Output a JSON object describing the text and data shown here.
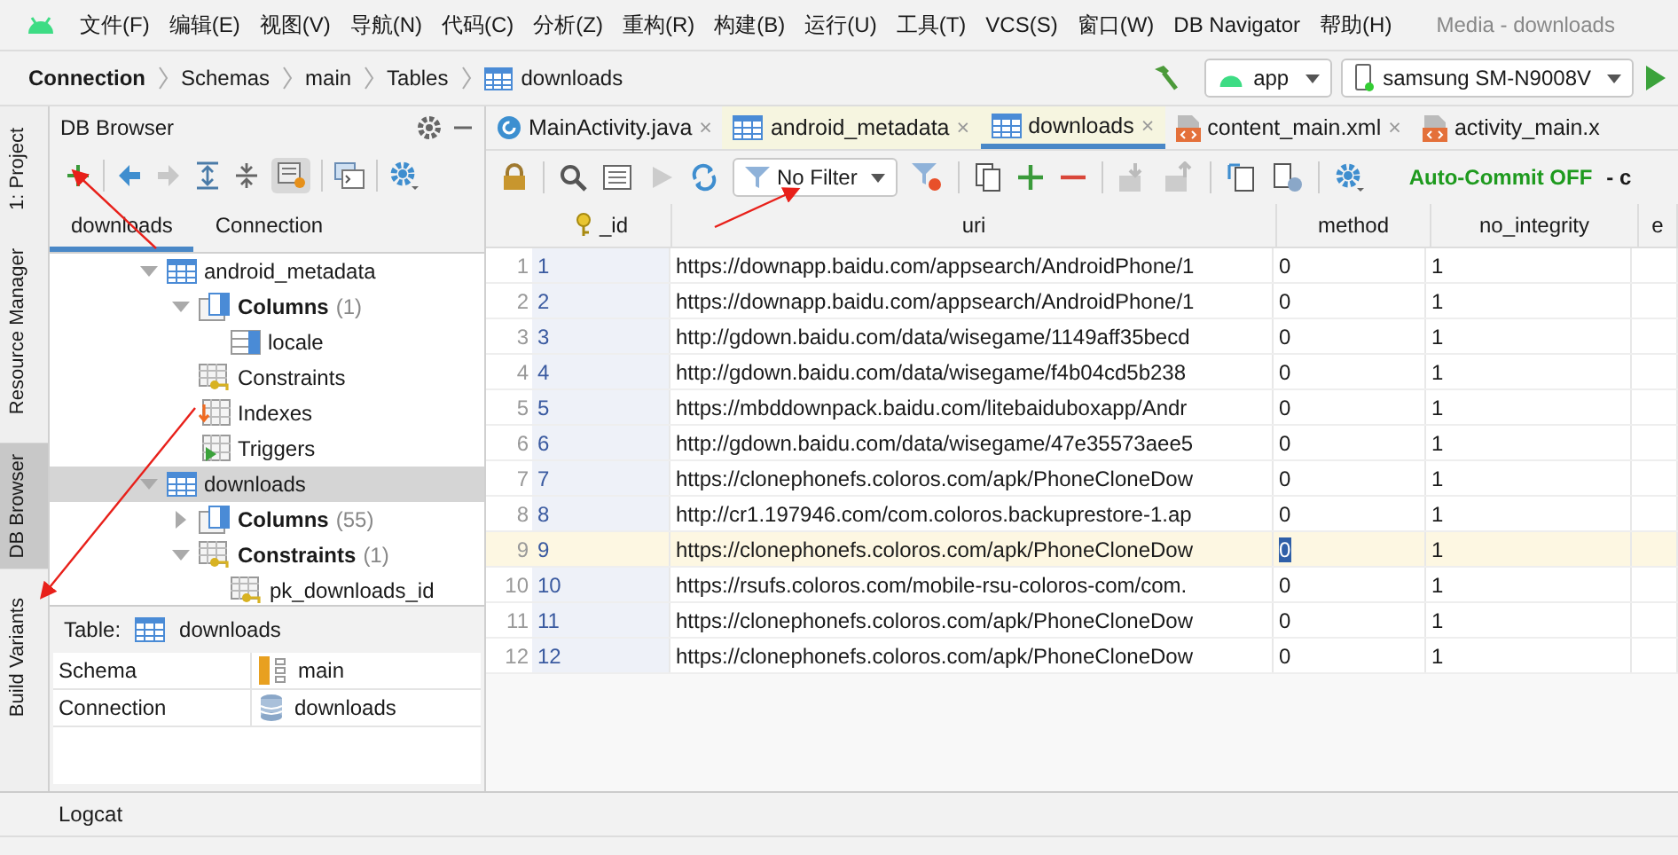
{
  "menu_bar": {
    "items": [
      "文件(F)",
      "编辑(E)",
      "视图(V)",
      "导航(N)",
      "代码(C)",
      "分析(Z)",
      "重构(R)",
      "构建(B)",
      "运行(U)",
      "工具(T)",
      "VCS(S)",
      "窗口(W)",
      "DB Navigator",
      "帮助(H)"
    ],
    "window_title": "Media - downloads"
  },
  "nav_bar": {
    "breadcrumbs": [
      {
        "label": "Connection",
        "kind": "bold"
      },
      {
        "label": "Schemas",
        "kind": "plain"
      },
      {
        "label": "main",
        "kind": "plain"
      },
      {
        "label": "Tables",
        "kind": "plain"
      },
      {
        "label": "downloads",
        "kind": "table"
      }
    ],
    "run_config": "app",
    "device": "samsung SM-N9008V"
  },
  "side_tabs": [
    {
      "label": "1: Project",
      "selected": false
    },
    {
      "label": "Resource Manager",
      "selected": false
    },
    {
      "label": "DB Browser",
      "selected": true
    },
    {
      "label": "Build Variants",
      "selected": false
    }
  ],
  "db_browser": {
    "title": "DB Browser",
    "tabs": [
      {
        "label": "downloads",
        "selected": true
      },
      {
        "label": "Connection",
        "selected": false
      }
    ],
    "tree": [
      {
        "label": "android_metadata",
        "kind": "table",
        "expanded": true,
        "selected": false,
        "children": [
          {
            "label": "Columns",
            "count": "(1)",
            "kind": "columns",
            "expanded": true,
            "selected": false,
            "children": [
              {
                "label": "locale",
                "kind": "column",
                "selected": false
              }
            ]
          },
          {
            "label": "Constraints",
            "kind": "constraints",
            "selected": false
          },
          {
            "label": "Indexes",
            "kind": "indexes",
            "selected": false
          },
          {
            "label": "Triggers",
            "kind": "triggers",
            "selected": false
          }
        ]
      },
      {
        "label": "downloads",
        "kind": "table",
        "expanded": true,
        "selected": true,
        "children": [
          {
            "label": "Columns",
            "count": "(55)",
            "kind": "columns",
            "expanded": false,
            "selected": false
          },
          {
            "label": "Constraints",
            "count": "(1)",
            "kind": "constraints",
            "expanded": true,
            "selected": false,
            "children": [
              {
                "label": "pk_downloads_id",
                "kind": "constraint",
                "selected": false
              }
            ]
          }
        ]
      }
    ]
  },
  "details": {
    "label": "Table:",
    "name": "downloads",
    "rows": [
      {
        "key": "Schema",
        "value": "main",
        "kind": "schema"
      },
      {
        "key": "Connection",
        "value": "downloads",
        "kind": "database"
      }
    ]
  },
  "editor_tabs": [
    {
      "label": "MainActivity.java",
      "kind": "java",
      "selected": false,
      "close": "×"
    },
    {
      "label": "android_metadata",
      "kind": "table",
      "selected": false,
      "close": "×"
    },
    {
      "label": "downloads",
      "kind": "table",
      "selected": true,
      "close": "×"
    },
    {
      "label": "content_main.xml",
      "kind": "xml",
      "selected": false,
      "close": "×"
    },
    {
      "label": "activity_main.x",
      "kind": "xml",
      "selected": false
    }
  ],
  "data_toolbar": {
    "filter": "No Filter",
    "auto_commit": "Auto-Commit OFF",
    "auto_commit_rest": "- c"
  },
  "table": {
    "columns": [
      "_id",
      "uri",
      "method",
      "no_integrity",
      "e"
    ],
    "rows": [
      {
        "row_number": "1",
        "cells": [
          "1",
          "https://downapp.baidu.com/appsearch/AndroidPhone/1",
          "0",
          "1"
        ],
        "selected": false
      },
      {
        "row_number": "2",
        "cells": [
          "2",
          "https://downapp.baidu.com/appsearch/AndroidPhone/1",
          "0",
          "1"
        ],
        "selected": false
      },
      {
        "row_number": "3",
        "cells": [
          "3",
          "http://gdown.baidu.com/data/wisegame/1149aff35becd",
          "0",
          "1"
        ],
        "selected": false
      },
      {
        "row_number": "4",
        "cells": [
          "4",
          "http://gdown.baidu.com/data/wisegame/f4b04cd5b238",
          "0",
          "1"
        ],
        "selected": false
      },
      {
        "row_number": "5",
        "cells": [
          "5",
          "https://mbddownpack.baidu.com/litebaiduboxapp/Andr",
          "0",
          "1"
        ],
        "selected": false
      },
      {
        "row_number": "6",
        "cells": [
          "6",
          "http://gdown.baidu.com/data/wisegame/47e35573aee5",
          "0",
          "1"
        ],
        "selected": false
      },
      {
        "row_number": "7",
        "cells": [
          "7",
          "https://clonephonefs.coloros.com/apk/PhoneCloneDow",
          "0",
          "1"
        ],
        "selected": false
      },
      {
        "row_number": "8",
        "cells": [
          "8",
          "http://cr1.197946.com/com.coloros.backuprestore-1.ap",
          "0",
          "1"
        ],
        "selected": false
      },
      {
        "row_number": "9",
        "cells": [
          "9",
          "https://clonephonefs.coloros.com/apk/PhoneCloneDow",
          "0",
          "1"
        ],
        "selected": true
      },
      {
        "row_number": "10",
        "cells": [
          "10",
          "https://rsufs.coloros.com/mobile-rsu-coloros-com/com.",
          "0",
          "1"
        ],
        "selected": false
      },
      {
        "row_number": "11",
        "cells": [
          "11",
          "https://clonephonefs.coloros.com/apk/PhoneCloneDow",
          "0",
          "1"
        ],
        "selected": false
      },
      {
        "row_number": "12",
        "cells": [
          "12",
          "https://clonephonefs.coloros.com/apk/PhoneCloneDow",
          "0",
          "1"
        ],
        "selected": false
      }
    ]
  },
  "bottom_bar": {
    "tab": "Logcat"
  }
}
